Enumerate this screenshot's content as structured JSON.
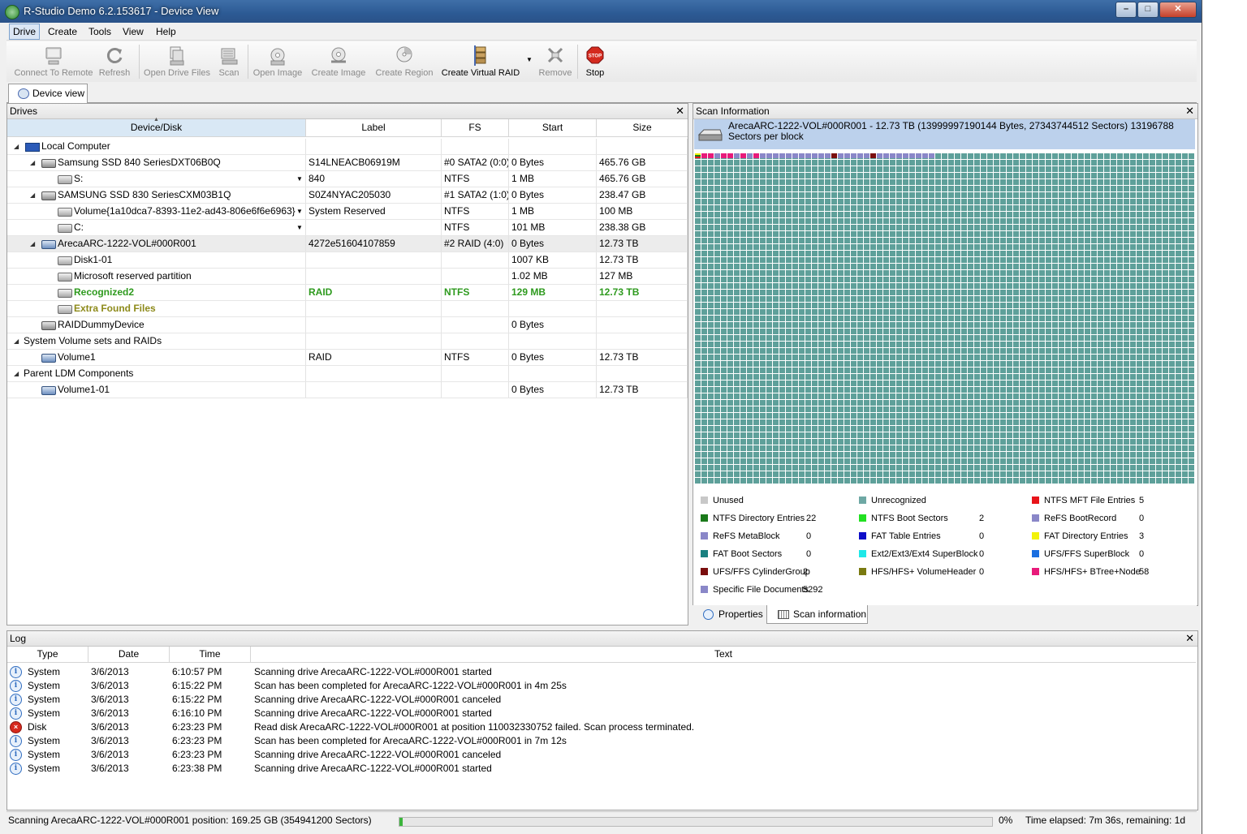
{
  "window": {
    "title": "R-Studio Demo 6.2.153617 - Device View"
  },
  "menu": [
    "Drive",
    "Create",
    "Tools",
    "View",
    "Help"
  ],
  "toolbar": {
    "connect": "Connect To Remote",
    "refresh": "Refresh",
    "open_drive_files": "Open Drive Files",
    "scan": "Scan",
    "open_image": "Open Image",
    "create_image": "Create Image",
    "create_region": "Create Region",
    "create_virtual_raid": "Create Virtual RAID",
    "remove": "Remove",
    "stop": "Stop",
    "stop_icon_text": "STOP"
  },
  "doc_tab": "Device view",
  "drives": {
    "title": "Drives",
    "columns": [
      "Device/Disk",
      "Label",
      "FS",
      "Start",
      "Size"
    ],
    "rows": [
      {
        "name": "Local Computer",
        "label": "",
        "fs": "",
        "start": "",
        "size": ""
      },
      {
        "name": "Samsung SSD 840 SeriesDXT06B0Q",
        "label": "S14LNEACB06919M",
        "fs": "#0 SATA2 (0:0)",
        "start": "0 Bytes",
        "size": "465.76 GB"
      },
      {
        "name": "S:",
        "label": "840",
        "fs": "NTFS",
        "start": "1 MB",
        "size": "465.76 GB"
      },
      {
        "name": "SAMSUNG SSD 830 SeriesCXM03B1Q",
        "label": "S0Z4NYAC205030",
        "fs": "#1 SATA2 (1:0)",
        "start": "0 Bytes",
        "size": "238.47 GB"
      },
      {
        "name": "Volume{1a10dca7-8393-11e2-ad43-806e6f6e6963}",
        "label": "System Reserved",
        "fs": "NTFS",
        "start": "1 MB",
        "size": "100 MB"
      },
      {
        "name": "C:",
        "label": "",
        "fs": "NTFS",
        "start": "101 MB",
        "size": "238.38 GB"
      },
      {
        "name": "ArecaARC-1222-VOL#000R001",
        "label": "4272e51604107859",
        "fs": "#2 RAID (4:0)",
        "start": "0 Bytes",
        "size": "12.73 TB"
      },
      {
        "name": "Disk1-01",
        "label": "",
        "fs": "",
        "start": "1007 KB",
        "size": "12.73 TB"
      },
      {
        "name": "Microsoft reserved partition",
        "label": "",
        "fs": "",
        "start": "1.02 MB",
        "size": "127 MB"
      },
      {
        "name": "Recognized2",
        "label": "RAID",
        "fs": "NTFS",
        "start": "129 MB",
        "size": "12.73 TB"
      },
      {
        "name": "Extra Found Files",
        "label": "",
        "fs": "",
        "start": "",
        "size": ""
      },
      {
        "name": "RAIDDummyDevice",
        "label": "",
        "fs": "",
        "start": "0 Bytes",
        "size": ""
      },
      {
        "name": "System Volume sets and RAIDs",
        "label": "",
        "fs": "",
        "start": "",
        "size": ""
      },
      {
        "name": "Volume1",
        "label": "RAID",
        "fs": "NTFS",
        "start": "0 Bytes",
        "size": "12.73 TB"
      },
      {
        "name": "Parent LDM Components",
        "label": "",
        "fs": "",
        "start": "",
        "size": ""
      },
      {
        "name": "Volume1-01",
        "label": "",
        "fs": "",
        "start": "0 Bytes",
        "size": "12.73 TB"
      }
    ]
  },
  "scan_info": {
    "title": "Scan Information",
    "header": "ArecaARC-1222-VOL#000R001 - 12.73 TB (13999997190144 Bytes, 27343744512 Sectors) 13196788 Sectors per block",
    "legend": [
      {
        "label": "Unused",
        "value": "",
        "color": "#c8c8c8"
      },
      {
        "label": "Unrecognized",
        "value": "",
        "color": "#6ea8a4"
      },
      {
        "label": "NTFS MFT File Entries",
        "value": "5",
        "color": "#e8141a"
      },
      {
        "label": "NTFS Directory Entries",
        "value": "22",
        "color": "#1b7a1b"
      },
      {
        "label": "NTFS Boot Sectors",
        "value": "2",
        "color": "#22e022"
      },
      {
        "label": "ReFS BootRecord",
        "value": "0",
        "color": "#8a87c8"
      },
      {
        "label": "ReFS MetaBlock",
        "value": "0",
        "color": "#8a87c8"
      },
      {
        "label": "FAT Table Entries",
        "value": "0",
        "color": "#0d0dc8"
      },
      {
        "label": "FAT Directory Entries",
        "value": "3",
        "color": "#f2f20a"
      },
      {
        "label": "FAT Boot Sectors",
        "value": "0",
        "color": "#1a8080"
      },
      {
        "label": "Ext2/Ext3/Ext4 SuperBlock",
        "value": "0",
        "color": "#1ee8e8"
      },
      {
        "label": "UFS/FFS SuperBlock",
        "value": "0",
        "color": "#1a6ee0"
      },
      {
        "label": "UFS/FFS CylinderGroup",
        "value": "2",
        "color": "#7a0e0e"
      },
      {
        "label": "HFS/HFS+ VolumeHeader",
        "value": "0",
        "color": "#7a7a10"
      },
      {
        "label": "HFS/HFS+ BTree+Node",
        "value": "58",
        "color": "#e81a7a"
      },
      {
        "label": "Specific File Documents",
        "value": "5292",
        "color": "#8a87c8"
      }
    ],
    "tabs": [
      "Properties",
      "Scan information"
    ]
  },
  "log": {
    "title": "Log",
    "columns": [
      "Type",
      "Date",
      "Time",
      "Text"
    ],
    "rows": [
      {
        "type": "System",
        "date": "3/6/2013",
        "time": "6:10:57 PM",
        "text": "Scanning drive ArecaARC-1222-VOL#000R001 started",
        "level": "info"
      },
      {
        "type": "System",
        "date": "3/6/2013",
        "time": "6:15:22 PM",
        "text": "Scan has been completed for ArecaARC-1222-VOL#000R001 in 4m 25s",
        "level": "info"
      },
      {
        "type": "System",
        "date": "3/6/2013",
        "time": "6:15:22 PM",
        "text": "Scanning drive ArecaARC-1222-VOL#000R001 canceled",
        "level": "info"
      },
      {
        "type": "System",
        "date": "3/6/2013",
        "time": "6:16:10 PM",
        "text": "Scanning drive ArecaARC-1222-VOL#000R001 started",
        "level": "info"
      },
      {
        "type": "Disk",
        "date": "3/6/2013",
        "time": "6:23:23 PM",
        "text": "Read disk ArecaARC-1222-VOL#000R001 at position 110032330752 failed. Scan process terminated.",
        "level": "error"
      },
      {
        "type": "System",
        "date": "3/6/2013",
        "time": "6:23:23 PM",
        "text": "Scan has been completed for ArecaARC-1222-VOL#000R001 in 7m 12s",
        "level": "info"
      },
      {
        "type": "System",
        "date": "3/6/2013",
        "time": "6:23:23 PM",
        "text": "Scanning drive ArecaARC-1222-VOL#000R001 canceled",
        "level": "info"
      },
      {
        "type": "System",
        "date": "3/6/2013",
        "time": "6:23:38 PM",
        "text": "Scanning drive ArecaARC-1222-VOL#000R001 started",
        "level": "info"
      }
    ]
  },
  "status": {
    "text": "Scanning ArecaARC-1222-VOL#000R001 position: 169.25 GB (354941200 Sectors)",
    "percent": "0%",
    "progress": 0.005,
    "elapsed": "Time elapsed: 7m 36s, remaining: 1d"
  }
}
